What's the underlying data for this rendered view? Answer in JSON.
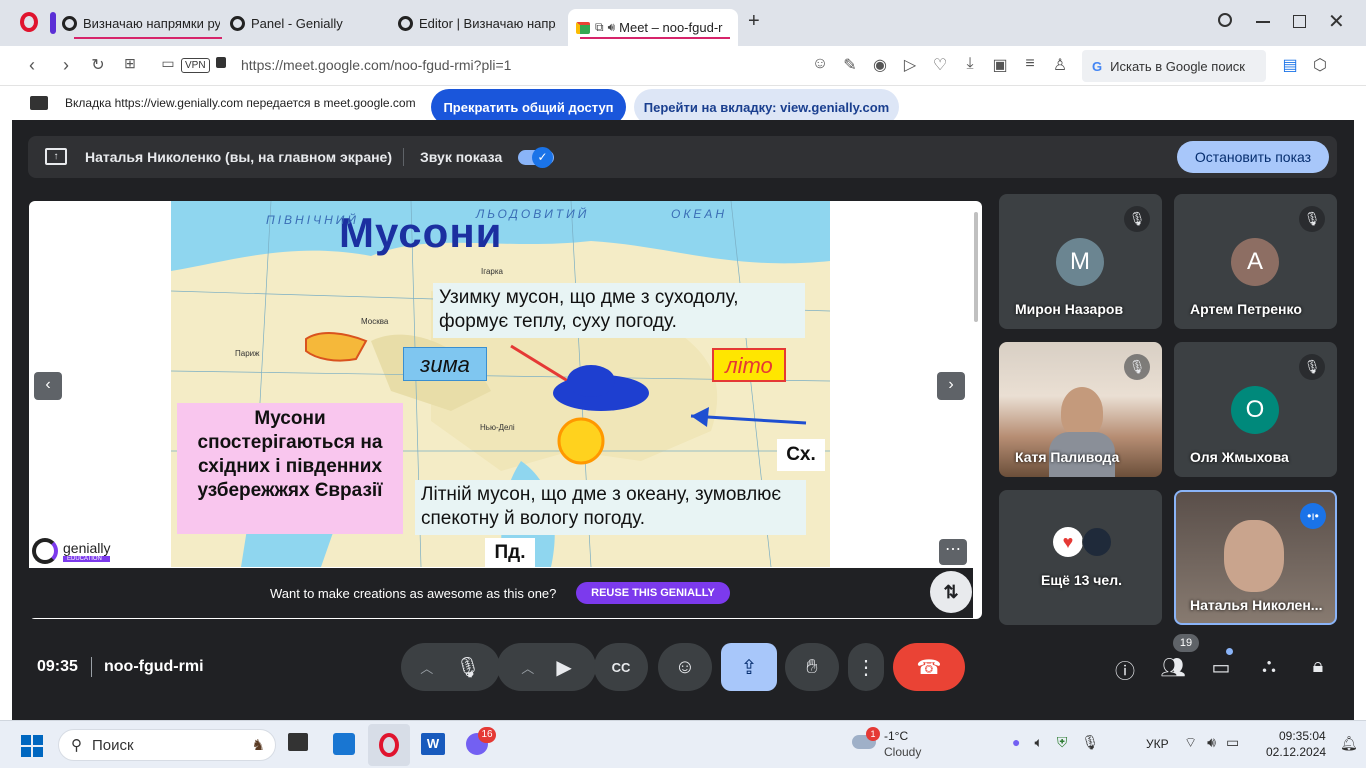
{
  "tabs": [
    {
      "title": "Визначаю напрямки рух",
      "active": false
    },
    {
      "title": "Panel - Genially",
      "active": false
    },
    {
      "title": "Editor | Визначаю напрям",
      "active": false
    },
    {
      "title": "Meet – noo-fgud-r",
      "active": true
    }
  ],
  "new_tab": "+",
  "address": {
    "vpn": "VPN",
    "url": "https://meet.google.com/noo-fgud-rmi?pli=1",
    "search_label": "Искать в Google поиск"
  },
  "share_banner": {
    "text": "Вкладка https://view.genially.com передается в meet.google.com",
    "stop_label": "Прекратить общий доступ",
    "goto_label": "Перейти на вкладку: view.genially.com"
  },
  "meet": {
    "presenter": "Наталья Николенко (вы, на главном экране)",
    "sound_label": "Звук показа",
    "stop_show_label": "Остановить показ",
    "slide": {
      "title": "Мусони",
      "winter_text": "Узимку мусон, що дме з суходолу, формує теплу, суху погоду.",
      "winter_label": "зима",
      "summer_label": "літо",
      "east_label": "Сх.",
      "south_label": "Пд.",
      "pink_text": "Мусони спостерігаються на східних і південних узбережжях Євразії",
      "summer_text": "Літній мусон, що дме з океану, зумовлює спекотну й вологу погоду.",
      "map_labels": [
        "ПІВНІЧНИЙ",
        "ЛЬОДОВИТИЙ",
        "ОКЕАН",
        "Москва",
        "Париж",
        "Ігарка",
        "Нью-Делі"
      ],
      "brand": "genially",
      "brand_sub": "EDUCATION"
    },
    "cta_text": "Want to make creations as awesome as this one?",
    "cta_button": "REUSE THIS GENIALLY",
    "participants": [
      {
        "name": "Мирон Назаров",
        "initial": "М",
        "color": "#6b8591",
        "muted": true
      },
      {
        "name": "Артем Петренко",
        "initial": "А",
        "color": "#8d6e63",
        "muted": true
      },
      {
        "name": "Катя Паливода",
        "initial": "",
        "color": "",
        "muted": true
      },
      {
        "name": "Оля Жмыхова",
        "initial": "О",
        "color": "#00897b",
        "muted": true
      },
      {
        "name": "Ещё 13 чел.",
        "initial": "",
        "color": "",
        "muted": false
      },
      {
        "name": "Наталья Николен...",
        "initial": "",
        "color": "",
        "muted": false
      }
    ],
    "time": "09:35",
    "meeting_code": "noo-fgud-rmi",
    "people_count": "19"
  },
  "taskbar": {
    "search_placeholder": "Поиск",
    "viber_badge": "16",
    "weather_badge": "1",
    "temp": "-1°C",
    "weather": "Cloudy",
    "lang": "УКР",
    "clock": "09:35:04",
    "date": "02.12.2024"
  }
}
